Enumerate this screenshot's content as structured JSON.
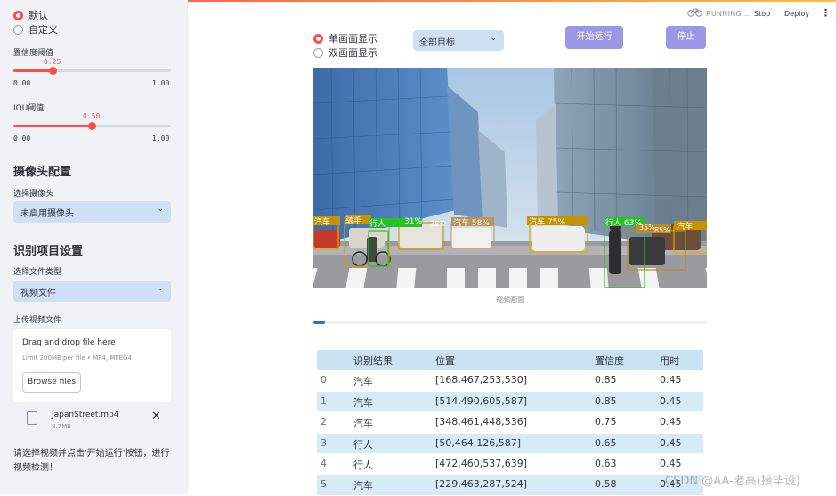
{
  "sidebar": {
    "mode_options": [
      {
        "label": "默认",
        "selected": true
      },
      {
        "label": "自定义",
        "selected": false
      }
    ],
    "confidence": {
      "label": "置信度阈值",
      "value": "0.25",
      "value_num": 0.25,
      "min": "0.00",
      "max": "1.00"
    },
    "iou": {
      "label": "IOU阈值",
      "value": "0.50",
      "value_num": 0.5,
      "min": "0.00",
      "max": "1.00"
    },
    "camera": {
      "heading": "摄像头配置",
      "select_label": "选择摄像头",
      "select_value": "未启用摄像头"
    },
    "recognition": {
      "heading": "识别项目设置",
      "type_label": "选择文件类型",
      "type_value": "视频文件"
    },
    "upload": {
      "label": "上传视频文件",
      "drop_text": "Drag and drop file here",
      "limit_text": "Limit 200MB per file • MP4, MPEG4",
      "browse_label": "Browse files",
      "file_name": "JapanStreet.mp4",
      "file_size": "8.7MB"
    },
    "hint": "请选择视频并点击'开始运行'按钮，进行视频检测！"
  },
  "header": {
    "running_label": "RUNNING...",
    "stop_label": "Stop",
    "deploy_label": "Deploy",
    "menu_icon": "vertical-dots-icon",
    "running_icon": "bicycle-icon"
  },
  "main": {
    "display_options": [
      {
        "label": "单画面显示",
        "selected": true
      },
      {
        "label": "双画面显示",
        "selected": false
      }
    ],
    "target_select": "全部目标",
    "start_button": "开始运行",
    "stop_button": "停止",
    "video_caption": "视频画面",
    "progress": 0.03,
    "detections": [
      {
        "label": "汽车"
      },
      {
        "label": "骑手"
      },
      {
        "label": "行人"
      },
      {
        "label": "31%"
      },
      {
        "label": "38%"
      },
      {
        "label": "汽车 58%"
      },
      {
        "label": "汽车 75%"
      },
      {
        "label": "行人 63%"
      },
      {
        "label": "35%"
      },
      {
        "label": "85%"
      },
      {
        "label": "汽车"
      }
    ],
    "table": {
      "columns": [
        "",
        "识别结果",
        "位置",
        "置信度",
        "用时"
      ],
      "rows": [
        [
          "0",
          "汽车",
          "[168,467,253,530]",
          "0.85",
          "0.45"
        ],
        [
          "1",
          "汽车",
          "[514,490,605,587]",
          "0.85",
          "0.45"
        ],
        [
          "2",
          "汽车",
          "[348,461,448,536]",
          "0.75",
          "0.45"
        ],
        [
          "3",
          "行人",
          "[50,464,126,587]",
          "0.65",
          "0.45"
        ],
        [
          "4",
          "行人",
          "[472,460,537,639]",
          "0.63",
          "0.45"
        ],
        [
          "5",
          "汽车",
          "[229,463,287,524]",
          "0.58",
          "0.45"
        ]
      ]
    }
  },
  "watermark": "CSDN @AA-老高(接毕设)",
  "colors": {
    "accent": "#ff4b4b",
    "button": "#9b97e6",
    "select_bg": "#cfe0f5",
    "progress": "#1f77d0"
  }
}
